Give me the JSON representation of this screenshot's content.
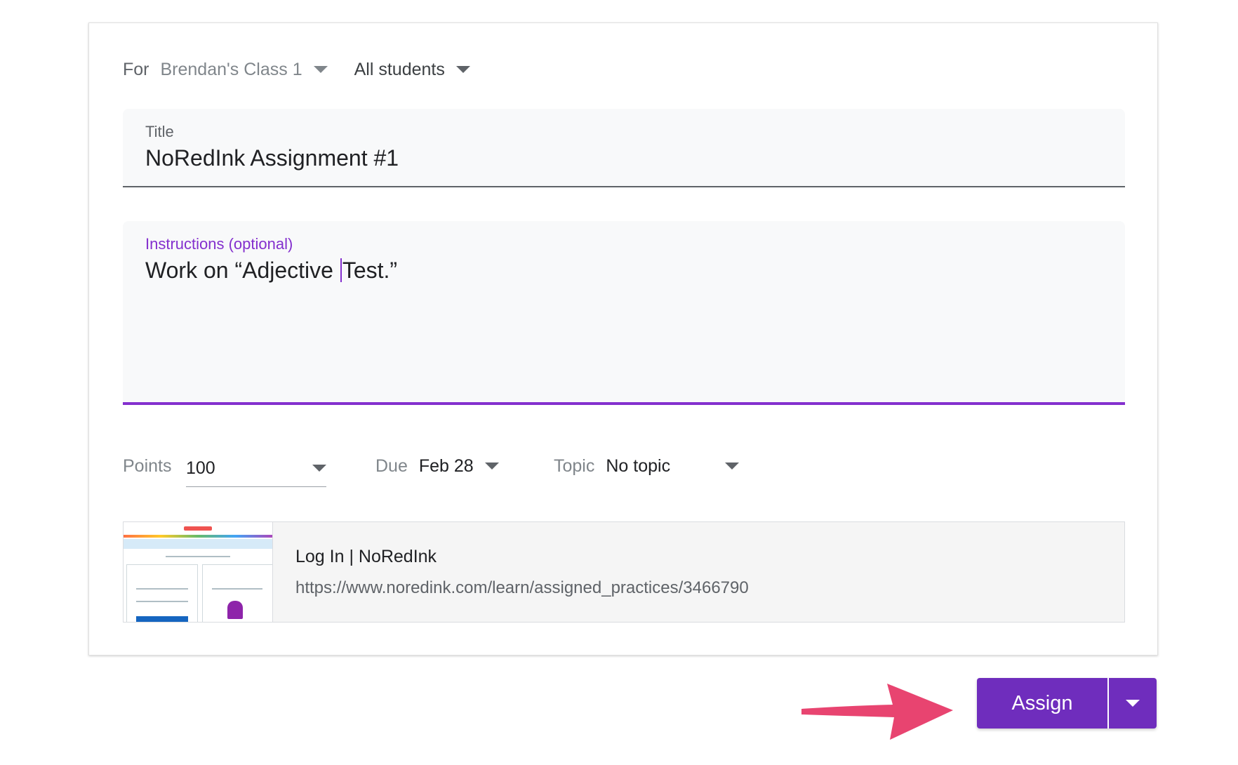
{
  "header": {
    "for_label": "For",
    "class_value": "Brendan's Class 1",
    "students_value": "All students"
  },
  "title_field": {
    "label": "Title",
    "value": "NoRedInk Assignment #1"
  },
  "instructions_field": {
    "label": "Instructions (optional)",
    "value_before_cursor": "Work on “Adjective ",
    "value_after_cursor": "Test.”"
  },
  "meta": {
    "points_label": "Points",
    "points_value": "100",
    "due_label": "Due",
    "due_value": "Feb 28",
    "topic_label": "Topic",
    "topic_value": "No topic"
  },
  "attachment": {
    "title": "Log In | NoRedInk",
    "url": "https://www.noredink.com/learn/assigned_practices/3466790"
  },
  "actions": {
    "assign_label": "Assign",
    "menu_icon": "caret-down-icon"
  },
  "colors": {
    "accent": "#8430ce",
    "assign_button": "#6f2dbd",
    "arrow": "#e84470"
  }
}
